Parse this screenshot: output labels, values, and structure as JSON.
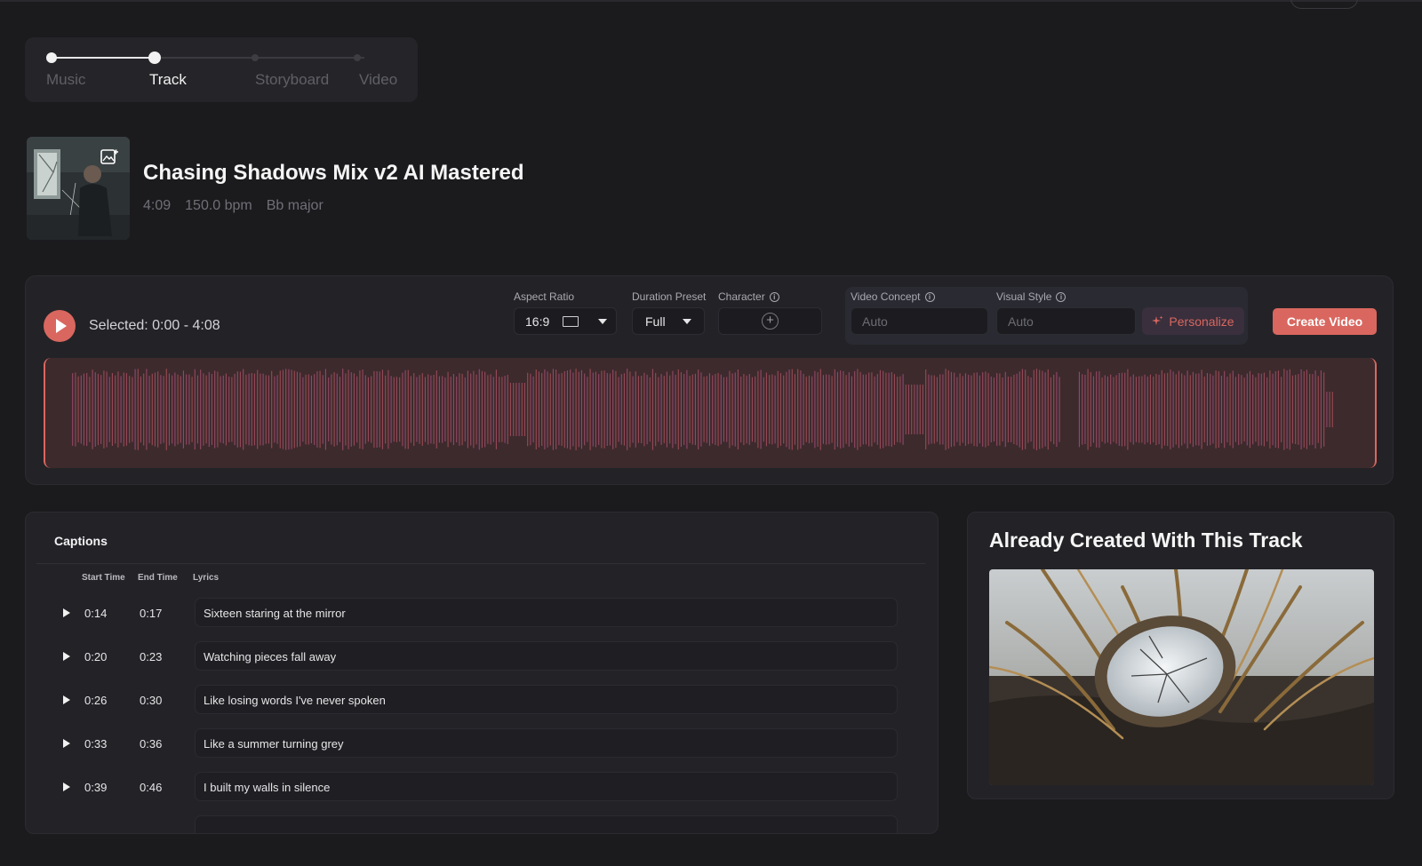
{
  "stepper": {
    "steps": [
      {
        "label": "Music",
        "state": "done"
      },
      {
        "label": "Track",
        "state": "current"
      },
      {
        "label": "Storyboard",
        "state": "todo"
      },
      {
        "label": "Video",
        "state": "todo"
      }
    ]
  },
  "track": {
    "title": "Chasing Shadows Mix v2 AI Mastered",
    "duration": "4:09",
    "bpm": "150.0 bpm",
    "key": "Bb major"
  },
  "player": {
    "selected": "Selected: 0:00 - 4:08",
    "aspect_ratio": {
      "label": "Aspect Ratio",
      "value": "16:9"
    },
    "duration_preset": {
      "label": "Duration Preset",
      "value": "Full"
    },
    "character": {
      "label": "Character"
    },
    "video_concept": {
      "label": "Video Concept",
      "placeholder": "Auto"
    },
    "visual_style": {
      "label": "Visual Style",
      "placeholder": "Auto"
    },
    "personalize_label": "Personalize",
    "create_label": "Create Video"
  },
  "captions": {
    "title": "Captions",
    "headers": {
      "start": "Start Time",
      "end": "End Time",
      "lyrics": "Lyrics"
    },
    "rows": [
      {
        "start": "0:14",
        "end": "0:17",
        "lyric": "Sixteen staring at the mirror"
      },
      {
        "start": "0:20",
        "end": "0:23",
        "lyric": "Watching pieces fall away"
      },
      {
        "start": "0:26",
        "end": "0:30",
        "lyric": "Like losing words I've never spoken"
      },
      {
        "start": "0:33",
        "end": "0:36",
        "lyric": "Like a summer turning grey"
      },
      {
        "start": "0:39",
        "end": "0:46",
        "lyric": "I built my walls in silence"
      }
    ]
  },
  "created": {
    "title": "Already Created With This Track"
  },
  "colors": {
    "accent": "#d9675f",
    "background": "#1b1b1e",
    "panel": "#232327",
    "waveform_start": "#6c3f78",
    "waveform_end": "#c3574f"
  }
}
